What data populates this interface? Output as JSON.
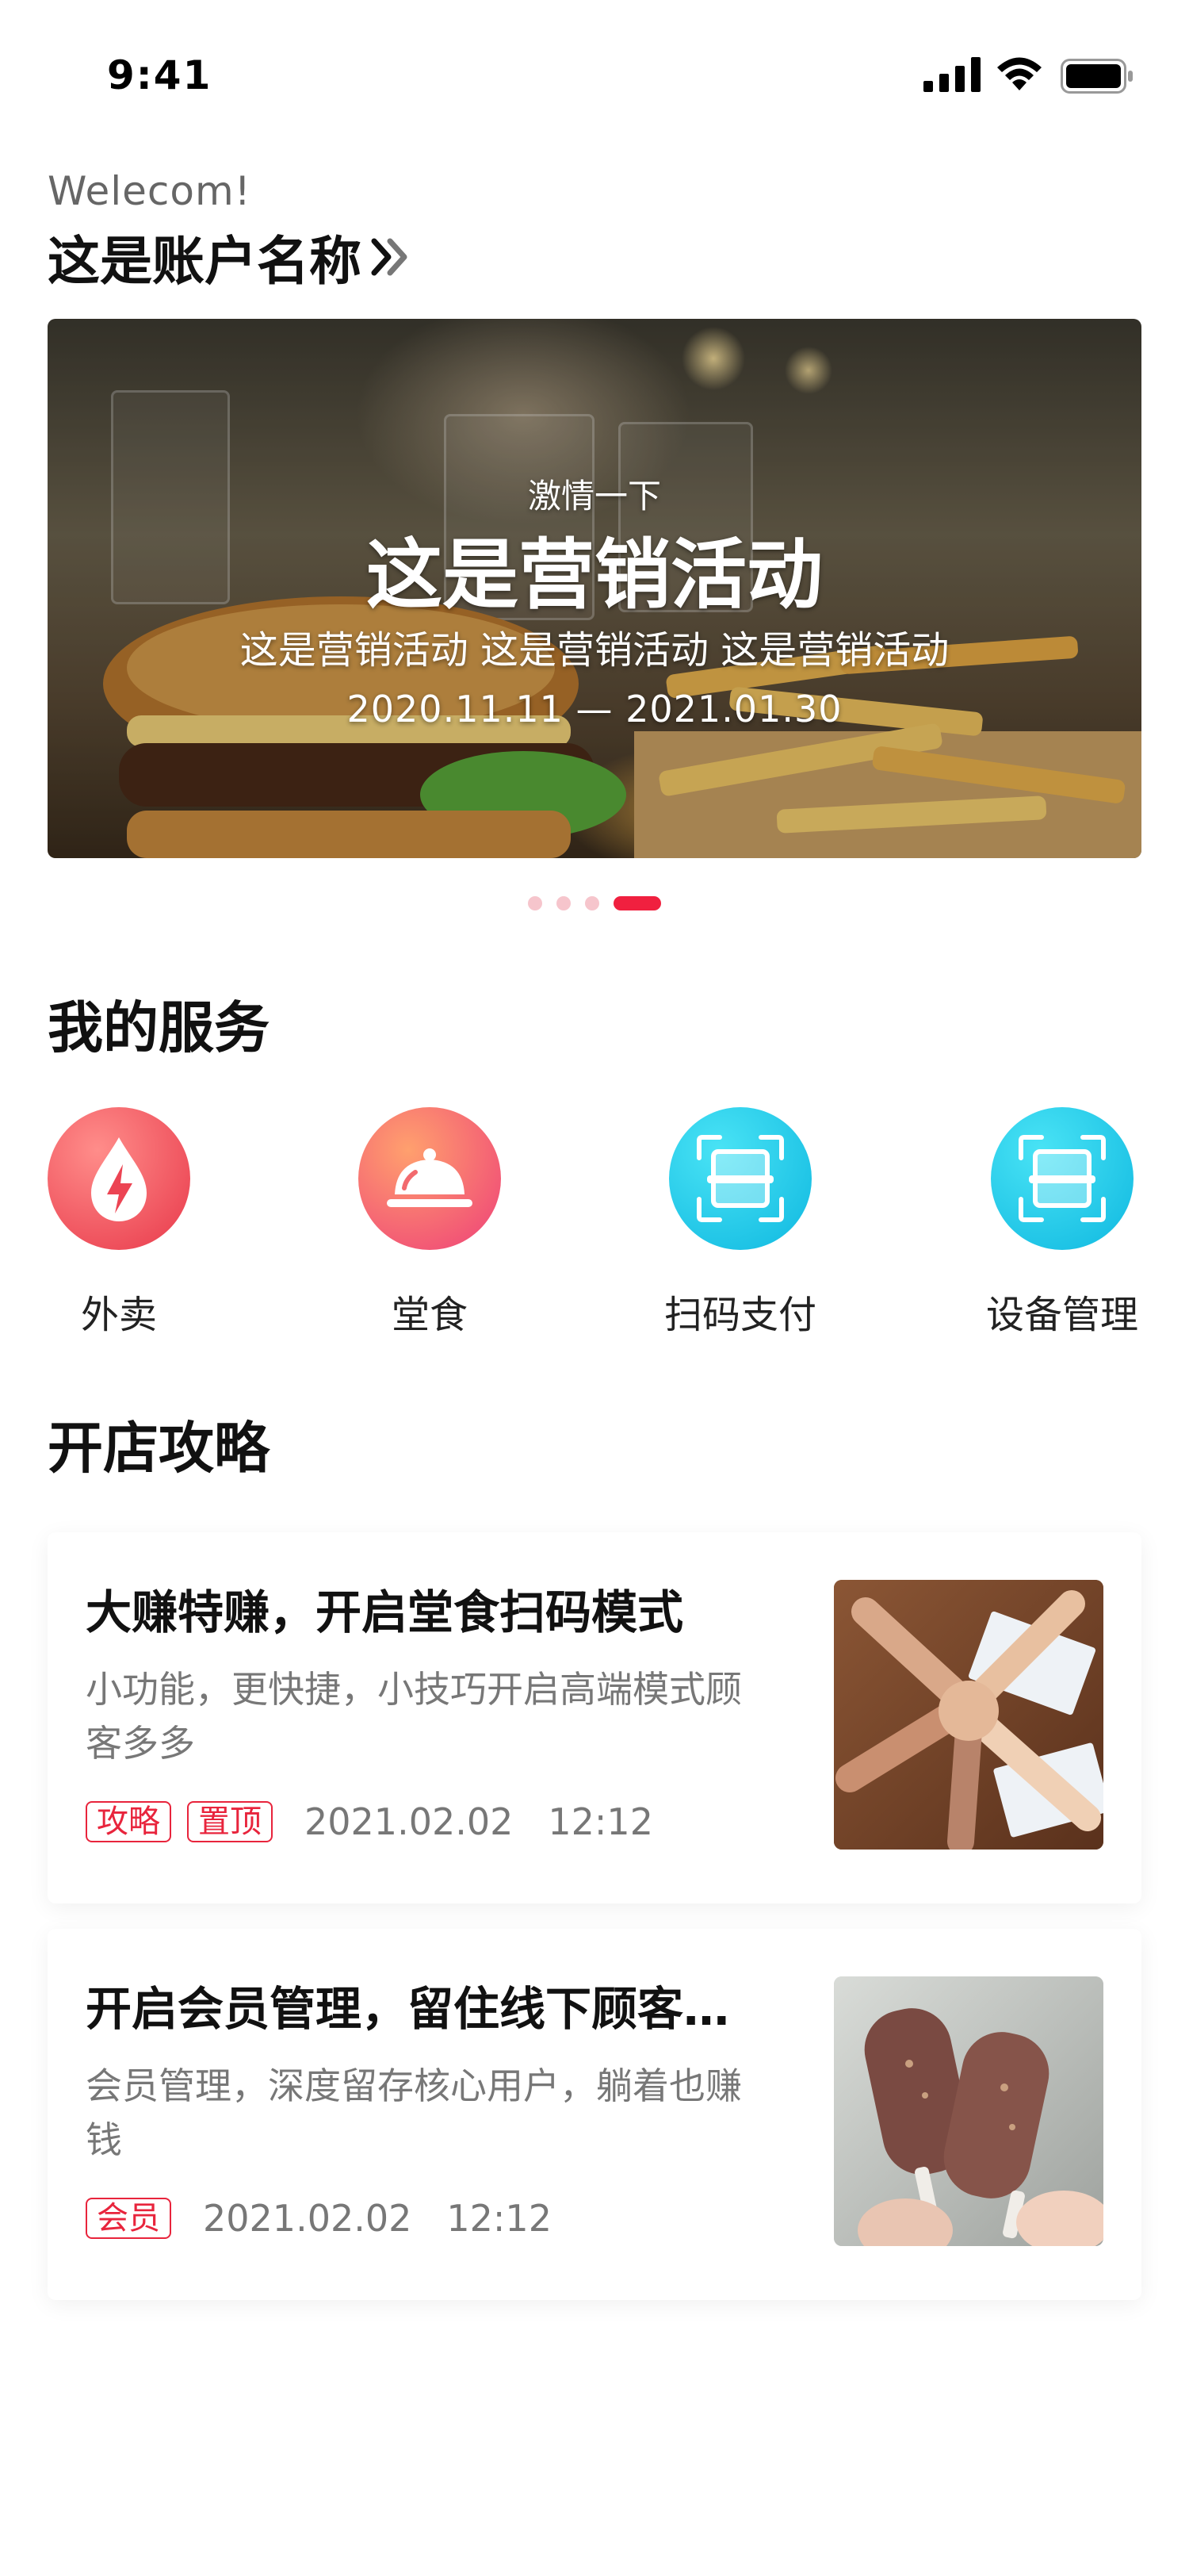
{
  "status_bar": {
    "time": "9:41",
    "signal_icon": "cellular-signal-icon",
    "wifi_icon": "wifi-icon",
    "battery_icon": "battery-icon"
  },
  "header": {
    "welcome": "Welecom!",
    "account_name": "这是账户名称"
  },
  "banner": {
    "tagline": "激情一下",
    "title": "这是营销活动",
    "subtitle": "这是营销活动 这是营销活动 这是营销活动",
    "date_range": "2020.11.11 — 2021.01.30",
    "page_count": 4,
    "active_page": 4
  },
  "services": {
    "title": "我的服务",
    "items": [
      {
        "label": "外卖",
        "icon": "delivery-bolt-icon"
      },
      {
        "label": "堂食",
        "icon": "dine-in-cloche-icon"
      },
      {
        "label": "扫码支付",
        "icon": "scan-pay-icon"
      },
      {
        "label": "设备管理",
        "icon": "device-manage-icon"
      }
    ]
  },
  "guides": {
    "title": "开店攻略",
    "articles": [
      {
        "title": "大赚特赚，开启堂食扫码模式",
        "description": "小功能，更快捷，小技巧开启高端模式顾客多多",
        "tags": [
          "攻略",
          "置顶"
        ],
        "date": "2021.02.02",
        "time": "12:12"
      },
      {
        "title": "开启会员管理，留住线下顾客…",
        "description": "会员管理，深度留存核心用户，躺着也赚钱",
        "tags": [
          "会员"
        ],
        "date": "2021.02.02",
        "time": "12:12"
      }
    ]
  },
  "colors": {
    "accent": "#f0203f",
    "tag": "#e8243c",
    "highlight": "#ffc0b0",
    "cyan": "#10c8e8"
  }
}
